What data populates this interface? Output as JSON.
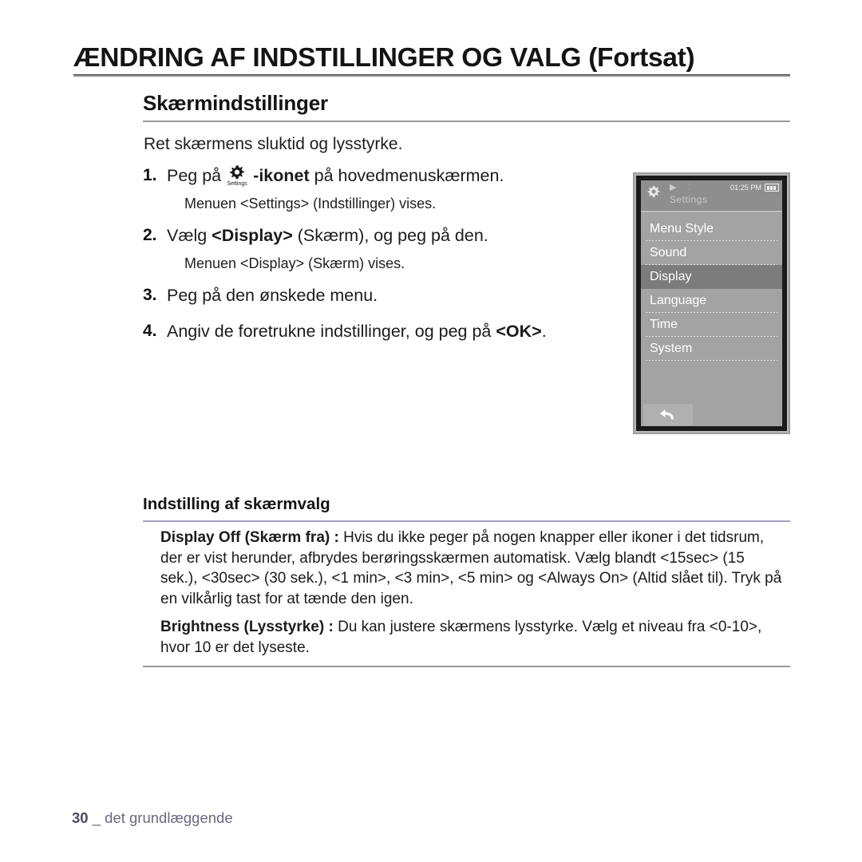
{
  "chapter": {
    "title": "ÆNDRING AF INDSTILLINGER OG VALG (Fortsat)"
  },
  "section": {
    "heading": "Skærmindstillinger",
    "intro": "Ret skærmens sluktid og lysstyrke."
  },
  "steps": [
    {
      "num": "1.",
      "before_icon": "Peg på",
      "icon_caption": "Settings",
      "after_icon_bold": "-ikonet",
      "after_icon": " på hovedmenuskærmen.",
      "sub": "Menuen <Settings> (Indstillinger) vises."
    },
    {
      "num": "2.",
      "text_a": "Vælg ",
      "text_bold": "<Display>",
      "text_b": " (Skærm), og peg på den.",
      "sub": "Menuen <Display> (Skærm) vises."
    },
    {
      "num": "3.",
      "text_a": "Peg på den ønskede menu.",
      "text_bold": "",
      "text_b": ""
    },
    {
      "num": "4.",
      "text_a": "Angiv de foretrukne indstillinger, og peg på ",
      "text_bold": "<OK>",
      "text_b": "."
    }
  ],
  "device": {
    "statusbar": {
      "title": "Settings",
      "time": "01:25 PM",
      "play_icon": "▶",
      "bluetooth_icon": "⁑"
    },
    "menu_items": [
      {
        "label": "Menu Style",
        "selected": false
      },
      {
        "label": "Sound",
        "selected": false
      },
      {
        "label": "Display",
        "selected": true
      },
      {
        "label": "Language",
        "selected": false
      },
      {
        "label": "Time",
        "selected": false
      },
      {
        "label": "System",
        "selected": false
      }
    ],
    "back_button": "back-arrow",
    "colors": {
      "screen_bg": "#a3a3a3",
      "statusbar_bg": "#8e8e8e",
      "selected_bg": "#7c7c7c",
      "frame": "#1a1a1a"
    }
  },
  "options": {
    "heading": "Indstilling af skærmvalg",
    "paragraphs": [
      {
        "term": "Display Off (Skærm fra) :",
        "body": " Hvis du ikke peger på nogen knapper eller ikoner i det tidsrum, der er vist herunder, afbrydes berøringsskærmen automatisk. Vælg blandt <15sec> (15 sek.), <30sec> (30 sek.), <1 min>, <3 min>, <5 min> og <Always On> (Altid slået til). Tryk på en vilkårlig tast for at tænde den igen."
      },
      {
        "term": "Brightness (Lysstyrke) :",
        "body": " Du kan justere skærmens lysstyrke. Vælg et niveau fra <0-10>, hvor 10 er det lyseste."
      }
    ]
  },
  "footer": {
    "page_number": "30",
    "separator": "_",
    "label": "det grundlæggende"
  },
  "colors": {
    "accent_rule": "#a79ec0",
    "gray_rule": "#9a9a9a",
    "footer_text": "#6b6880"
  }
}
